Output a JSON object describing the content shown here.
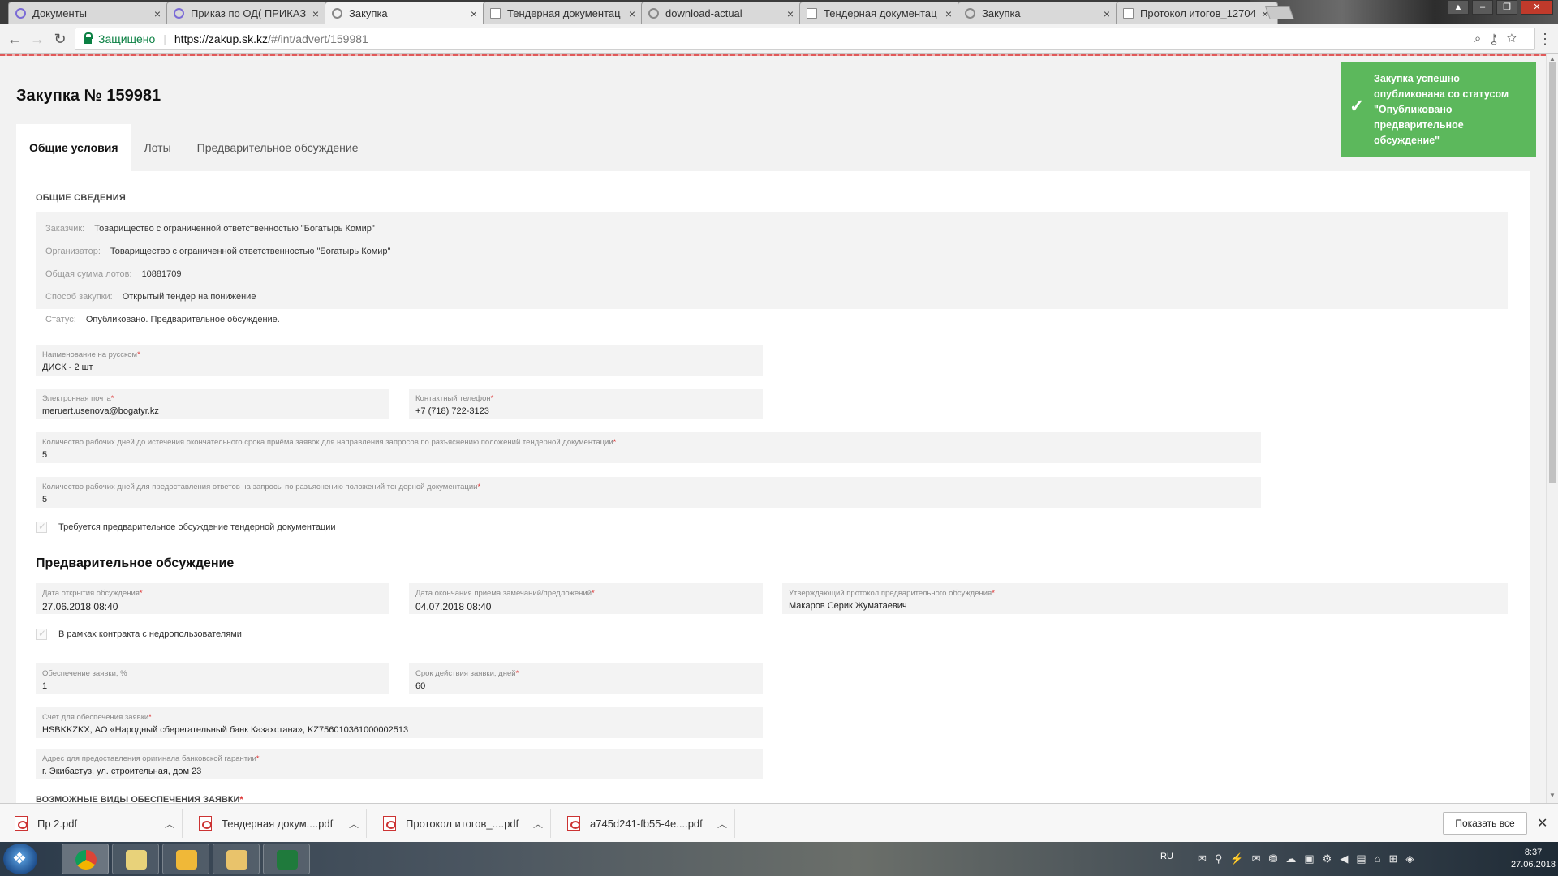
{
  "browser": {
    "tabs": [
      {
        "title": "Документы",
        "icon": "circle-icon"
      },
      {
        "title": "Приказ по ОД( ПРИКАЗ",
        "icon": "circle-icon"
      },
      {
        "title": "Закупка",
        "icon": "globe-icon",
        "active": true
      },
      {
        "title": "Тендерная документац",
        "icon": "doc-icon"
      },
      {
        "title": "download-actual",
        "icon": "globe-icon"
      },
      {
        "title": "Тендерная документац",
        "icon": "doc-icon"
      },
      {
        "title": "Закупка",
        "icon": "globe-icon"
      },
      {
        "title": "Протокол итогов_12704",
        "icon": "doc-icon"
      }
    ],
    "secure_label": "Защищено",
    "url_host": "https://zakup.sk.kz",
    "url_path": "/#/int/advert/159981"
  },
  "page": {
    "title": "Закупка № 159981",
    "tabs": [
      "Общие условия",
      "Лоты",
      "Предварительное обсуждение"
    ],
    "general_heading": "ОБЩИЕ СВЕДЕНИЯ",
    "info": [
      {
        "key": "Заказчик:",
        "value": "Товарищество с ограниченной ответственностью \"Богатырь Комир\""
      },
      {
        "key": "Организатор:",
        "value": "Товарищество с ограниченной ответственностью \"Богатырь Комир\""
      },
      {
        "key": "Общая сумма лотов:",
        "value": "10881709"
      },
      {
        "key": "Способ закупки:",
        "value": "Открытый тендер на понижение"
      },
      {
        "key": "Статус:",
        "value": "Опубликовано. Предварительное обсуждение."
      }
    ],
    "fields": {
      "name_ru": {
        "label": "Наименование на русском",
        "value": "ДИСК - 2 шт"
      },
      "email": {
        "label": "Электронная почта",
        "value": "meruert.usenova@bogatyr.kz"
      },
      "phone": {
        "label": "Контактный телефон",
        "value": "+7 (718) 722-3123"
      },
      "days_requests": {
        "label": "Количество рабочих дней до истечения окончательного срока приёма заявок для направления запросов по разъяснению положений тендерной документации",
        "value": "5"
      },
      "days_answers": {
        "label": "Количество рабочих дней для предоставления ответов на запросы по разъяснению положений тендерной документации",
        "value": "5"
      },
      "discussion_open": {
        "label": "Дата открытия обсуждения",
        "value": "27.06.2018 08:40"
      },
      "discussion_end": {
        "label": "Дата окончания приема замечаний/предложений",
        "value": "04.07.2018 08:40"
      },
      "approver": {
        "label": "Утверждающий протокол предварительного обсуждения",
        "value": "Макаров Серик Жуматаевич"
      },
      "security_percent": {
        "label": "Обеспечение заявки, %",
        "value": "1"
      },
      "validity_days": {
        "label": "Срок действия заявки, дней",
        "value": "60"
      },
      "account": {
        "label": "Счет для обеспечения заявки",
        "value": "HSBKKZKX, АО «Народный сберегательный банк Казахстана», KZ756010361000002513"
      },
      "guarantee_address": {
        "label": "Адрес для предоставления оригинала банковской гарантии",
        "value": "г. Экибастуз, ул. строительная, дом 23"
      }
    },
    "checkbox_prelim": "Требуется предварительное обсуждение тендерной документации",
    "section_prelim": "Предварительное обсуждение",
    "checkbox_subsoil": "В рамках контракта с недропользователями",
    "cut_heading": "ВОЗМОЖНЫЕ ВИДЫ ОБЕСПЕЧЕНИЯ ЗАЯВКИ"
  },
  "toast": {
    "text": "Закупка успешно опубликована со статусом \"Опубликовано предварительное обсуждение\"",
    "color": "#5cb85c"
  },
  "downloads": {
    "items": [
      "Пр 2.pdf",
      "Тендерная докум....pdf",
      "Протокол итогов_....pdf",
      "a745d241-fb55-4e....pdf"
    ],
    "show_all": "Показать все"
  },
  "taskbar": {
    "lang": "RU",
    "time": "8:37",
    "date": "27.06.2018"
  }
}
